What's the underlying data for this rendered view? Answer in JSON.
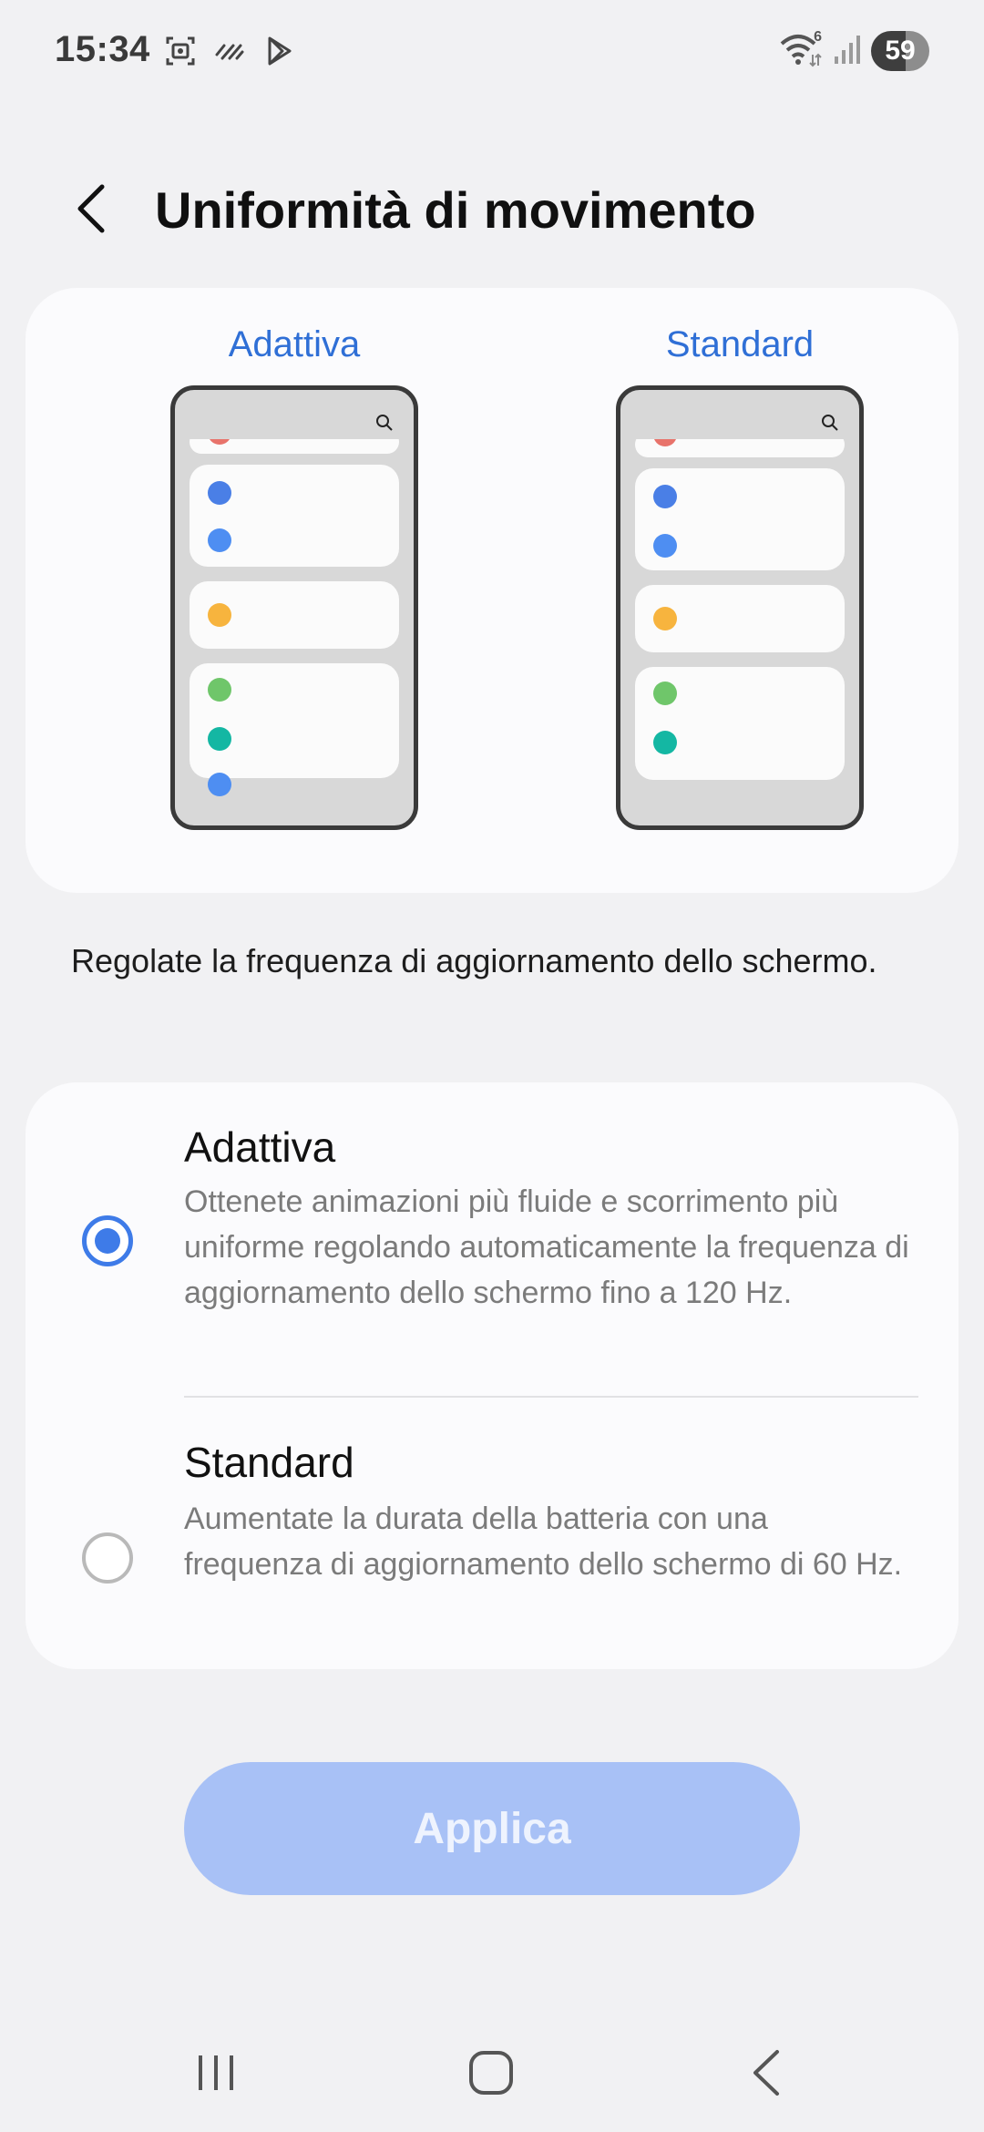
{
  "status_bar": {
    "time": "15:34",
    "left_icons": [
      "screenshot-icon",
      "data-saver-icon",
      "play-store-icon"
    ],
    "right_icons": [
      "wifi-icon",
      "signal-icon"
    ],
    "wifi_badge": "6",
    "battery": "59"
  },
  "header": {
    "title": "Uniformità di movimento"
  },
  "preview": {
    "adaptive_label": "Adattiva",
    "standard_label": "Standard"
  },
  "description": "Regolate la frequenza di aggiornamento dello schermo.",
  "options": [
    {
      "title": "Adattiva",
      "description": "Ottenete animazioni più fluide e scorrimento più uniforme regolando automaticamente la frequenza di aggiornamento dello schermo fino a 120 Hz.",
      "selected": true
    },
    {
      "title": "Standard",
      "description": "Aumentate la durata della batteria con una frequenza di aggiornamento dello schermo di 60 Hz.",
      "selected": false
    }
  ],
  "apply_button": {
    "label": "Applica"
  },
  "colors": {
    "accent": "#3e7be8",
    "label_blue": "#2f6fd6",
    "apply_disabled": "#a8c1f6",
    "dot_red": "#e8736b",
    "dot_blue": "#4a7fe6",
    "dot_lightblue": "#4e8ef2",
    "dot_yellow": "#f7b43e",
    "dot_green": "#6fc66a",
    "dot_teal": "#14b7a3"
  },
  "nav_bar": {
    "icons": [
      "recent-apps-icon",
      "home-icon",
      "back-icon"
    ]
  }
}
